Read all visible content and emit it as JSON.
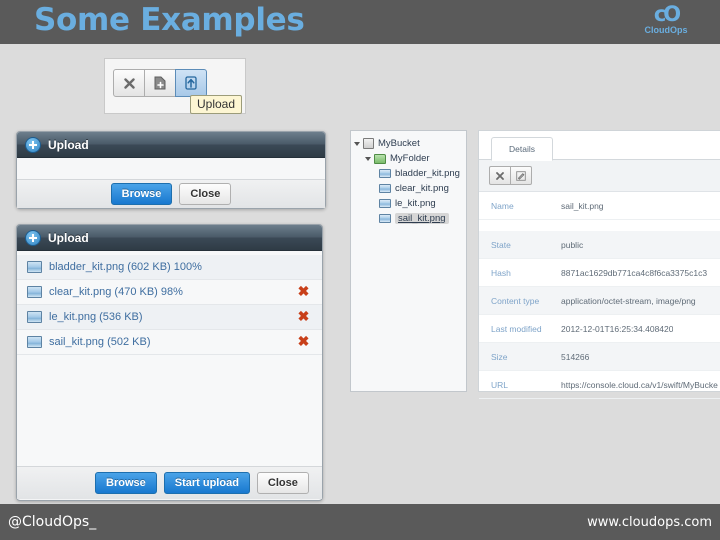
{
  "header": {
    "title": "Some Examples",
    "logo_mark": "cO",
    "logo_name": "CloudOps"
  },
  "footer": {
    "handle": "@CloudOps_",
    "website": "www.cloudops.com"
  },
  "toolbar_widget": {
    "buttons": [
      {
        "name": "delete-button",
        "icon": "x-icon"
      },
      {
        "name": "new-file-button",
        "icon": "file-plus-icon"
      },
      {
        "name": "upload-button",
        "icon": "upload-icon"
      }
    ],
    "tooltip": "Upload"
  },
  "upload_dialog_empty": {
    "title": "Upload",
    "title_icon": "plus-circle-icon",
    "buttons": {
      "browse": "Browse",
      "close": "Close"
    }
  },
  "upload_dialog_progress": {
    "title": "Upload",
    "title_icon": "plus-circle-icon",
    "files": [
      {
        "label": "bladder_kit.png (602 KB) 100%",
        "removable": false
      },
      {
        "label": "clear_kit.png (470 KB) 98%",
        "removable": true
      },
      {
        "label": "le_kit.png (536 KB)",
        "removable": true
      },
      {
        "label": "sail_kit.png (502 KB)",
        "removable": true
      }
    ],
    "remove_icon": "remove-x-icon",
    "buttons": {
      "browse": "Browse",
      "start_upload": "Start upload",
      "close": "Close"
    }
  },
  "tree_panel": {
    "bucket": "MyBucket",
    "folder": "MyFolder",
    "files": [
      "bladder_kit.png",
      "clear_kit.png",
      "le_kit.png",
      "sail_kit.png"
    ],
    "selected": "sail_kit.png"
  },
  "details_panel": {
    "tab": "Details",
    "toolbar": [
      {
        "name": "delete-object-button",
        "icon": "x-icon"
      },
      {
        "name": "edit-object-button",
        "icon": "pencil-icon"
      }
    ],
    "properties": [
      {
        "key": "Name",
        "value": "sail_kit.png"
      },
      {
        "key": "State",
        "value": "public"
      },
      {
        "key": "Hash",
        "value": "8871ac1629db771ca4c8f6ca3375c1c3"
      },
      {
        "key": "Content type",
        "value": "application/octet-stream, image/png"
      },
      {
        "key": "Last modified",
        "value": "2012-12-01T16:25:34.408420"
      },
      {
        "key": "Size",
        "value": "514266"
      },
      {
        "key": "URL",
        "value": "https://console.cloud.ca/v1/swift/MyBucke"
      }
    ]
  },
  "colors": {
    "slide_bg": "#dcdcdc",
    "bar_bg": "#5a5a5a",
    "accent_blue": "#6aaee0",
    "button_blue": "#1878cf",
    "link_blue": "#3f6ea0",
    "remove_red": "#c8401a"
  }
}
